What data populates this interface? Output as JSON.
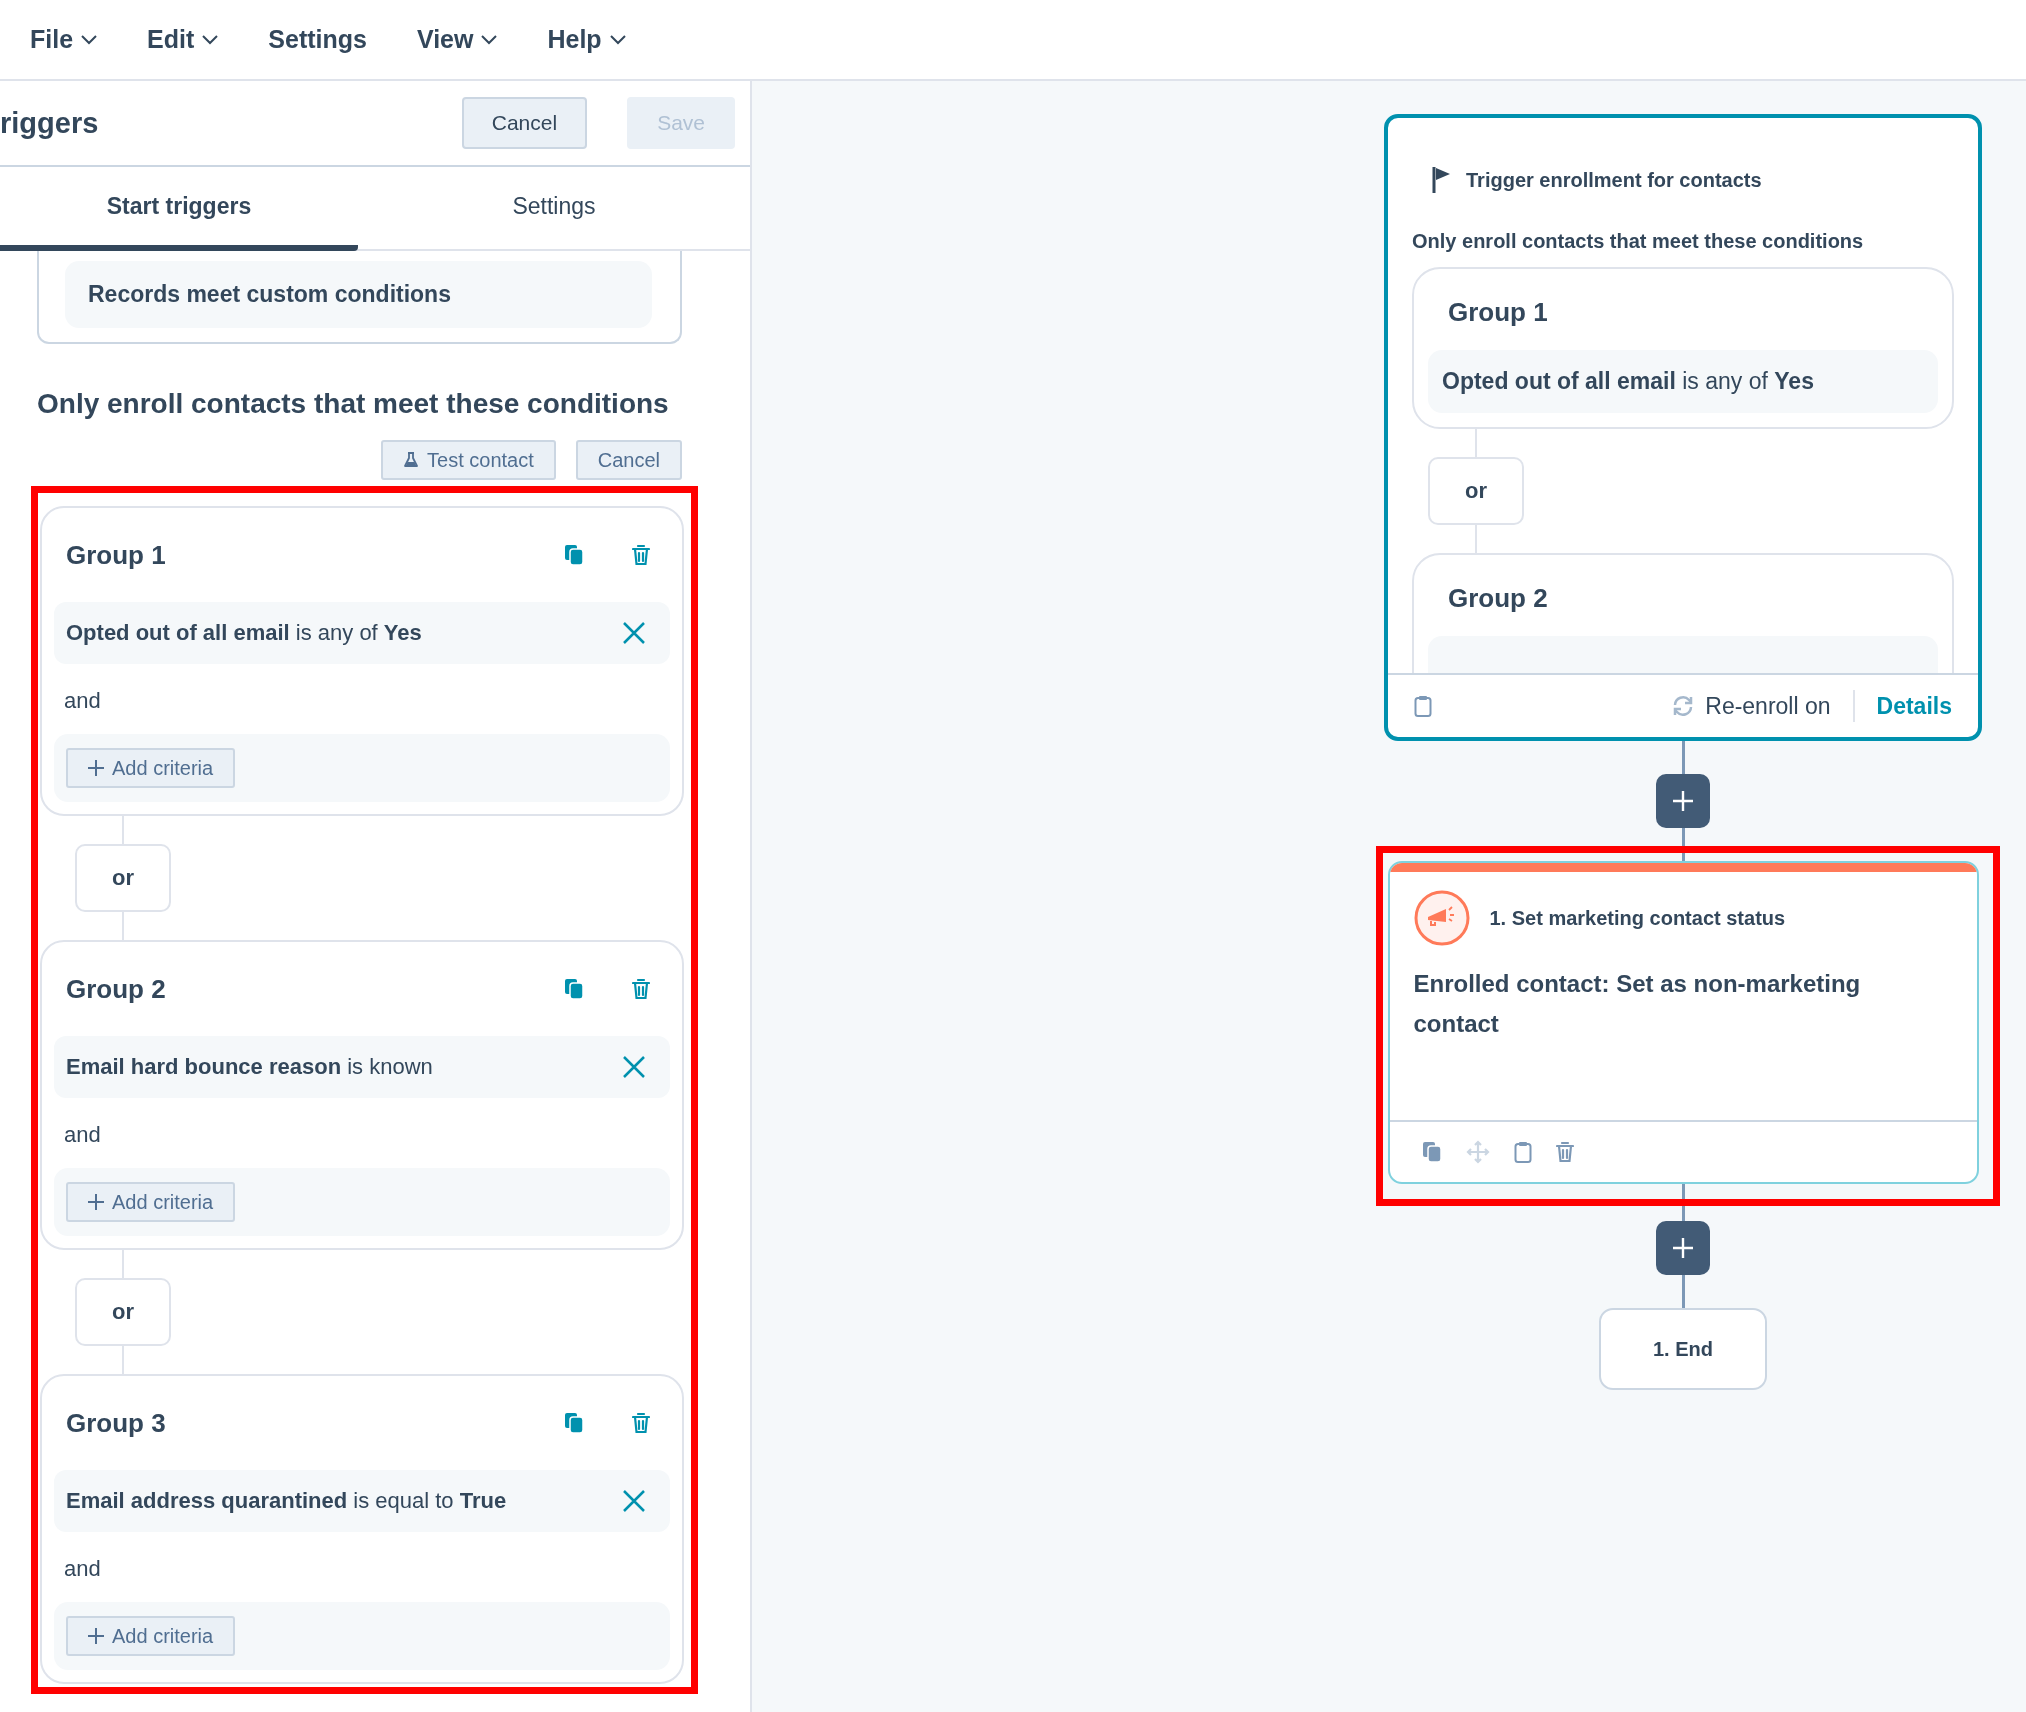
{
  "menu": [
    {
      "label": "File",
      "dropdown": true
    },
    {
      "label": "Edit",
      "dropdown": true
    },
    {
      "label": "Settings",
      "dropdown": false
    },
    {
      "label": "View",
      "dropdown": true
    },
    {
      "label": "Help",
      "dropdown": true
    }
  ],
  "panel": {
    "title": "riggers",
    "buttons": [
      {
        "label": "Cancel",
        "disabled": false
      },
      {
        "label": "Save",
        "disabled": true
      }
    ]
  },
  "tabs": [
    {
      "label": "Start triggers",
      "selected": true
    },
    {
      "label": "Settings",
      "selected": false
    }
  ],
  "trigger_type": "Records meet custom conditions",
  "conditions_heading": "Only enroll contacts that meet these conditions",
  "condition_actions": [
    {
      "label": "Test contact",
      "kind": "test"
    },
    {
      "label": "Cancel",
      "kind": "plain"
    }
  ],
  "groups_highlighted": true,
  "groups": [
    {
      "title": "Group 1",
      "criteria": [
        "**Opted out of all email** is any of **Yes**"
      ],
      "joiner": "and",
      "add_label": "Add criteria"
    },
    {
      "separator": "or",
      "title": "Group 2",
      "criteria": [
        "**Email hard bounce reason** is known"
      ],
      "joiner": "and",
      "add_label": "Add criteria"
    },
    {
      "separator": "or",
      "title": "Group 3",
      "criteria": [
        "**Email address quarantined** is equal to **True**"
      ],
      "joiner": "and",
      "add_label": "Add criteria"
    }
  ],
  "workflow": {
    "trigger": {
      "title": "Trigger enrollment for contacts",
      "subtitle": "Only enroll contacts that meet these conditions",
      "groups": [
        {
          "title": "Group 1",
          "criteria": "**Opted out of all email** is any of **Yes**"
        },
        {
          "separator": "or",
          "title": "Group 2"
        }
      ],
      "reenroll": "Re-enroll on",
      "details": "Details"
    },
    "actions": [
      {
        "title": "1. Set marketing contact status",
        "body": "Enrolled contact: Set as non-marketing contact",
        "highlighted": true
      }
    ],
    "end": "1. End"
  }
}
